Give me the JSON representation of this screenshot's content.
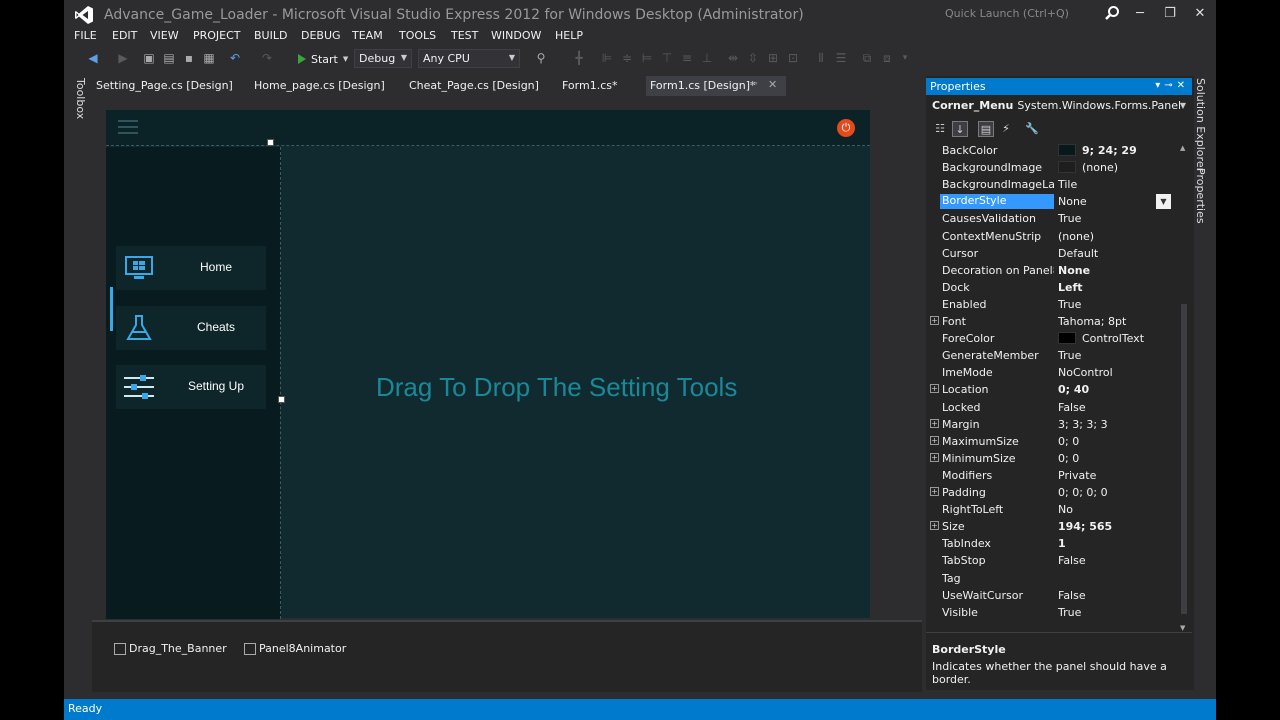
{
  "window": {
    "title": "Advance_Game_Loader - Microsoft Visual Studio Express 2012 for Windows Desktop (Administrator)",
    "quick_launch_placeholder": "Quick Launch (Ctrl+Q)",
    "controls": {
      "minimize": "─",
      "restore": "❐",
      "close": "✕"
    }
  },
  "menu": [
    "FILE",
    "EDIT",
    "VIEW",
    "PROJECT",
    "BUILD",
    "DEBUG",
    "TEAM",
    "TOOLS",
    "TEST",
    "WINDOW",
    "HELP"
  ],
  "toolbar": {
    "start_label": "Start",
    "config_value": "Debug",
    "platform_value": "Any CPU"
  },
  "toolbox_label": "Toolbox",
  "doc_tabs": [
    {
      "label": "Setting_Page.cs [Design]",
      "active": false
    },
    {
      "label": "Home_page.cs [Design]",
      "active": false
    },
    {
      "label": "Cheat_Page.cs [Design]",
      "active": false
    },
    {
      "label": "Form1.cs*",
      "active": false
    },
    {
      "label": "Form1.cs [Design]*",
      "active": true
    }
  ],
  "designer": {
    "menu_buttons": [
      {
        "label": "Home",
        "icon": "windows-monitor-icon"
      },
      {
        "label": "Cheats",
        "icon": "flask-icon"
      },
      {
        "label": "Setting Up",
        "icon": "sliders-icon"
      }
    ],
    "placeholder_text": "Drag To Drop The Setting Tools"
  },
  "component_tray": [
    "Drag_The_Banner",
    "Panel8Animator"
  ],
  "properties": {
    "title": "Properties",
    "object_name": "Corner_Menu",
    "object_type": "System.Windows.Forms.Panel",
    "rows": [
      {
        "name": "BackColor",
        "value": "9; 24; 29",
        "bold": true,
        "swatch": "#09181d"
      },
      {
        "name": "BackgroundImage",
        "value": "(none)",
        "swatch": "#1e1e1e"
      },
      {
        "name": "BackgroundImageLayout",
        "value": "Tile"
      },
      {
        "name": "BorderStyle",
        "value": "None",
        "selected": true
      },
      {
        "name": "CausesValidation",
        "value": "True"
      },
      {
        "name": "ContextMenuStrip",
        "value": "(none)"
      },
      {
        "name": "Cursor",
        "value": "Default"
      },
      {
        "name": "Decoration on Panel8Animator",
        "value": "None",
        "bold": true
      },
      {
        "name": "Dock",
        "value": "Left",
        "bold": true
      },
      {
        "name": "Enabled",
        "value": "True"
      },
      {
        "name": "Font",
        "value": "Tahoma; 8pt",
        "expand": true
      },
      {
        "name": "ForeColor",
        "value": "ControlText",
        "swatch": "#000000"
      },
      {
        "name": "GenerateMember",
        "value": "True"
      },
      {
        "name": "ImeMode",
        "value": "NoControl"
      },
      {
        "name": "Location",
        "value": "0; 40",
        "bold": true,
        "expand": true
      },
      {
        "name": "Locked",
        "value": "False"
      },
      {
        "name": "Margin",
        "value": "3; 3; 3; 3",
        "expand": true
      },
      {
        "name": "MaximumSize",
        "value": "0; 0",
        "expand": true
      },
      {
        "name": "MinimumSize",
        "value": "0; 0",
        "expand": true
      },
      {
        "name": "Modifiers",
        "value": "Private"
      },
      {
        "name": "Padding",
        "value": "0; 0; 0; 0",
        "expand": true
      },
      {
        "name": "RightToLeft",
        "value": "No"
      },
      {
        "name": "Size",
        "value": "194; 565",
        "bold": true,
        "expand": true
      },
      {
        "name": "TabIndex",
        "value": "1",
        "bold": true
      },
      {
        "name": "TabStop",
        "value": "False"
      },
      {
        "name": "Tag",
        "value": ""
      },
      {
        "name": "UseWaitCursor",
        "value": "False"
      },
      {
        "name": "Visible",
        "value": "True"
      }
    ],
    "description_title": "BorderStyle",
    "description_text": "Indicates whether the panel should have a border."
  },
  "right_strip": {
    "solution_explorer": "Solution Explorer",
    "properties": "Properties"
  },
  "status": "Ready"
}
